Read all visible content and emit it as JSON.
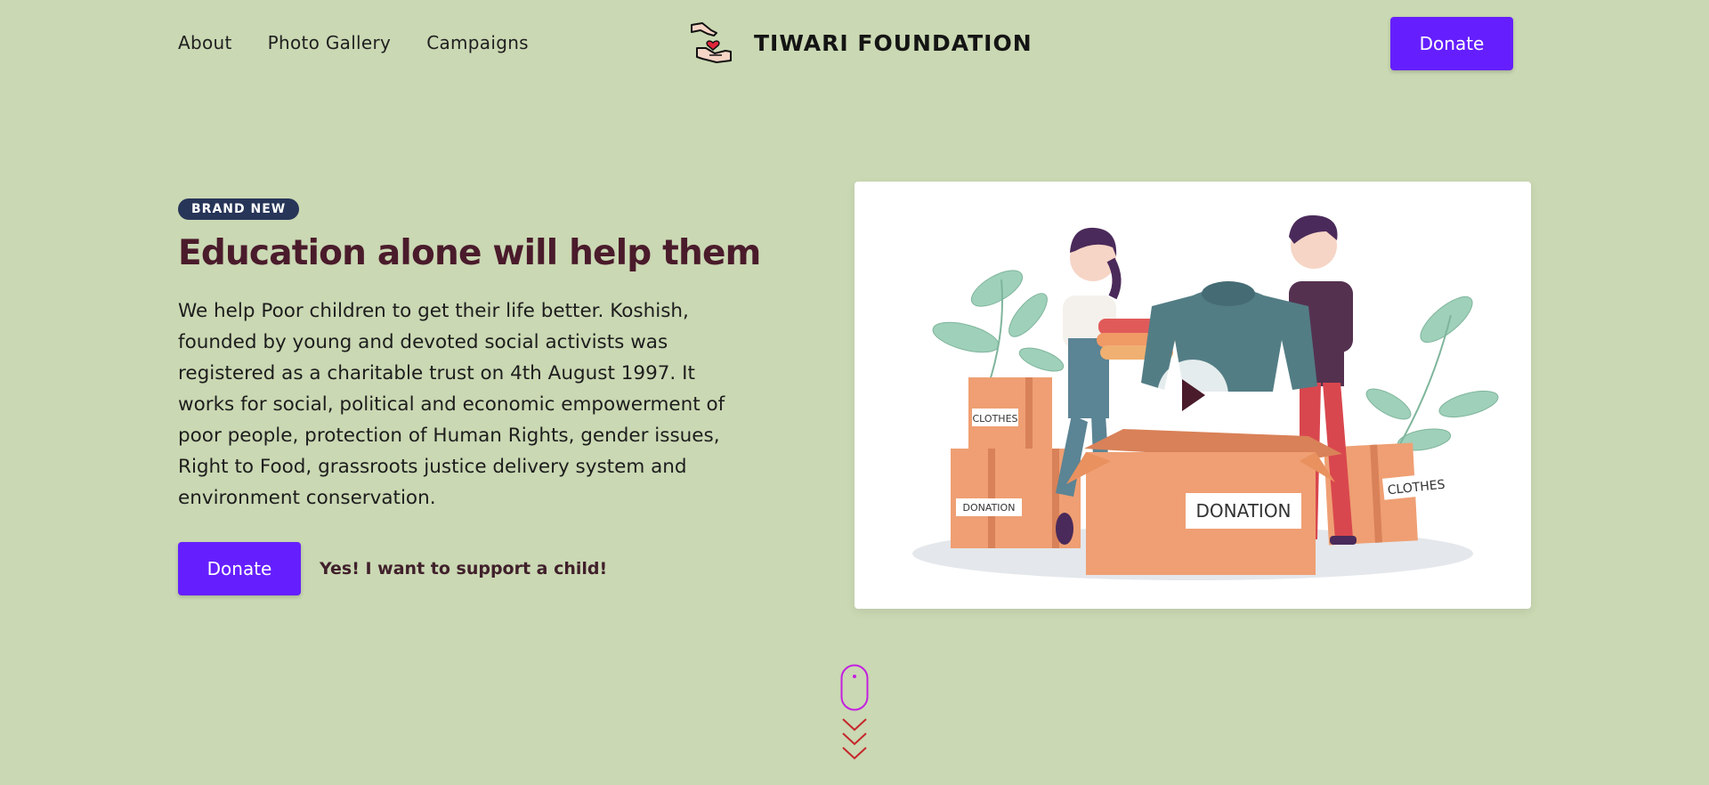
{
  "nav": {
    "links": [
      "About",
      "Photo Gallery",
      "Campaigns"
    ]
  },
  "brand": {
    "name": "TIWARI FOUNDATION",
    "logo_icon": "hand-heart-icon"
  },
  "header": {
    "donate_label": "Donate"
  },
  "hero": {
    "badge": "BRAND NEW",
    "title": "Education alone will help them",
    "description": "We help Poor children to get their life better. Koshish, founded by young and devoted social activists was registered as a charitable trust on 4th August 1997. It works for social, political and economic empowerment of poor people, protection of Human Rights, gender issues, Right to Food, grassroots justice delivery system and environment conservation.",
    "donate_label": "Donate",
    "support_label": "Yes! I want to support a child!",
    "image": {
      "box_labels": [
        "CLOTHES",
        "DONATION",
        "DONATION",
        "CLOTHES"
      ],
      "play_icon": "play-icon"
    }
  },
  "scroll": {
    "icon": "mouse-scroll-icon"
  },
  "colors": {
    "background": "#cad8b3",
    "accent": "#651ffe",
    "badge": "#273558",
    "headline": "#4a1b2b",
    "scroll_mouse": "#c41fe0",
    "scroll_chevrons": "#c4272c"
  }
}
